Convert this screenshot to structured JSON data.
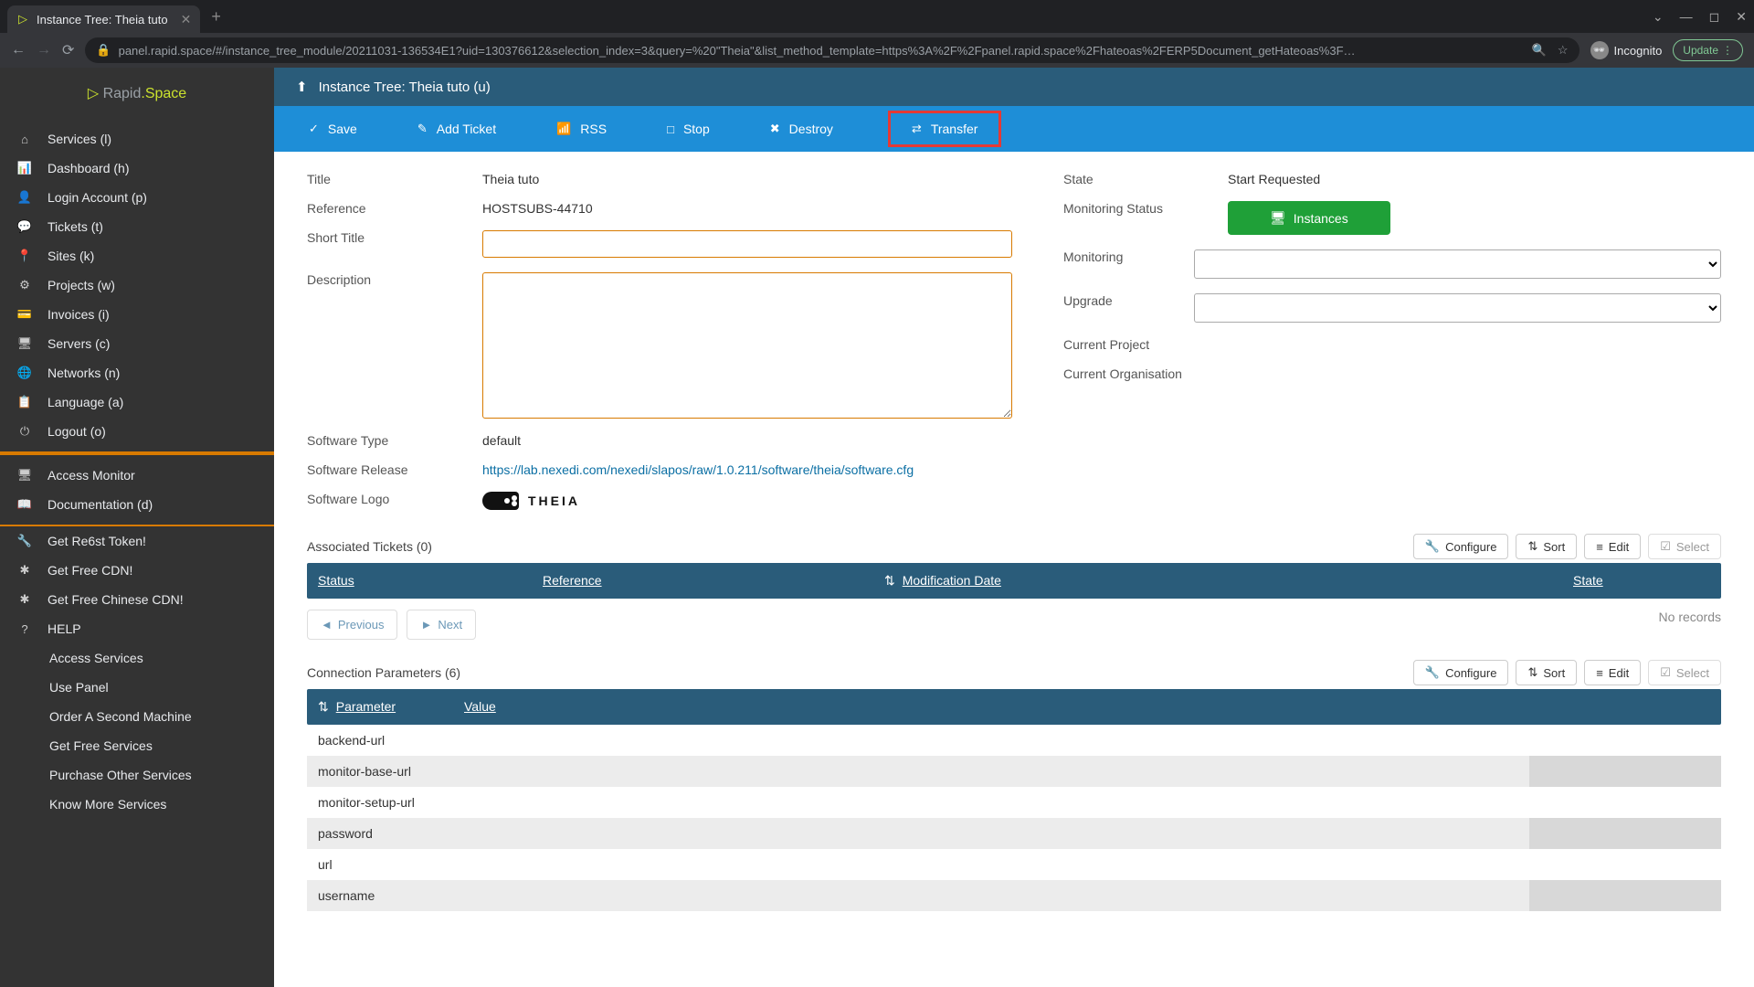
{
  "browser": {
    "tab_title": "Instance Tree: Theia tuto",
    "url": "panel.rapid.space/#/instance_tree_module/20211031-136534E1?uid=130376612&selection_index=3&query=%20\"Theia\"&list_method_template=https%3A%2F%2Fpanel.rapid.space%2Fhateoas%2FERP5Document_getHateoas%3F…",
    "incognito": "Incognito",
    "update": "Update"
  },
  "logo": {
    "brand1": "Rapid",
    "brand2": ".Space"
  },
  "sidebar": {
    "main": [
      {
        "label": "Services (l)",
        "icon": "⌂"
      },
      {
        "label": "Dashboard (h)",
        "icon": "📊"
      },
      {
        "label": "Login Account (p)",
        "icon": "👤"
      },
      {
        "label": "Tickets (t)",
        "icon": "💬"
      },
      {
        "label": "Sites (k)",
        "icon": "📍"
      },
      {
        "label": "Projects (w)",
        "icon": "⚙"
      },
      {
        "label": "Invoices (i)",
        "icon": "💳"
      },
      {
        "label": "Servers (c)",
        "icon": "🖥"
      },
      {
        "label": "Networks (n)",
        "icon": "🌐"
      },
      {
        "label": "Language (a)",
        "icon": "📋"
      },
      {
        "label": "Logout (o)",
        "icon": "⏻"
      }
    ],
    "mid": [
      {
        "label": "Access Monitor",
        "icon": "🖥"
      },
      {
        "label": "Documentation (d)",
        "icon": "📖"
      }
    ],
    "promo": [
      {
        "label": "Get Re6st Token!",
        "icon": "🔧"
      },
      {
        "label": "Get Free CDN!",
        "icon": "✱"
      },
      {
        "label": "Get Free Chinese CDN!",
        "icon": "✱"
      }
    ],
    "help_label": "HELP",
    "help": [
      "Access Services",
      "Use Panel",
      "Order A Second Machine",
      "Get Free Services",
      "Purchase Other Services",
      "Know More Services"
    ]
  },
  "header": {
    "title": "Instance Tree: Theia tuto (u)"
  },
  "actions": {
    "save": "Save",
    "add_ticket": "Add Ticket",
    "rss": "RSS",
    "stop": "Stop",
    "destroy": "Destroy",
    "transfer": "Transfer"
  },
  "fields": {
    "title_label": "Title",
    "title_value": "Theia tuto",
    "reference_label": "Reference",
    "reference_value": "HOSTSUBS-44710",
    "short_title_label": "Short Title",
    "short_title_value": "",
    "description_label": "Description",
    "description_value": "",
    "software_type_label": "Software Type",
    "software_type_value": "default",
    "software_release_label": "Software Release",
    "software_release_value": "https://lab.nexedi.com/nexedi/slapos/raw/1.0.211/software/theia/software.cfg",
    "software_logo_label": "Software Logo",
    "software_logo_text": "THEIA",
    "state_label": "State",
    "state_value": "Start Requested",
    "mon_status_label": "Monitoring Status",
    "instances_btn": "Instances",
    "monitoring_label": "Monitoring",
    "upgrade_label": "Upgrade",
    "cur_project_label": "Current Project",
    "cur_org_label": "Current Organisation"
  },
  "tickets": {
    "title": "Associated Tickets (0)",
    "cols": {
      "status": "Status",
      "reference": "Reference",
      "mod": "Modification Date",
      "state": "State"
    },
    "prev": "Previous",
    "next": "Next",
    "none": "No records"
  },
  "conn": {
    "title": "Connection Parameters (6)",
    "cols": {
      "parameter": "Parameter",
      "value": "Value"
    },
    "rows": [
      {
        "p": "backend-url",
        "v": ""
      },
      {
        "p": "monitor-base-url",
        "v": ""
      },
      {
        "p": "monitor-setup-url",
        "v": ""
      },
      {
        "p": "password",
        "v": ""
      },
      {
        "p": "url",
        "v": ""
      },
      {
        "p": "username",
        "v": ""
      }
    ]
  },
  "tools": {
    "configure": "Configure",
    "sort": "Sort",
    "edit": "Edit",
    "select": "Select"
  }
}
